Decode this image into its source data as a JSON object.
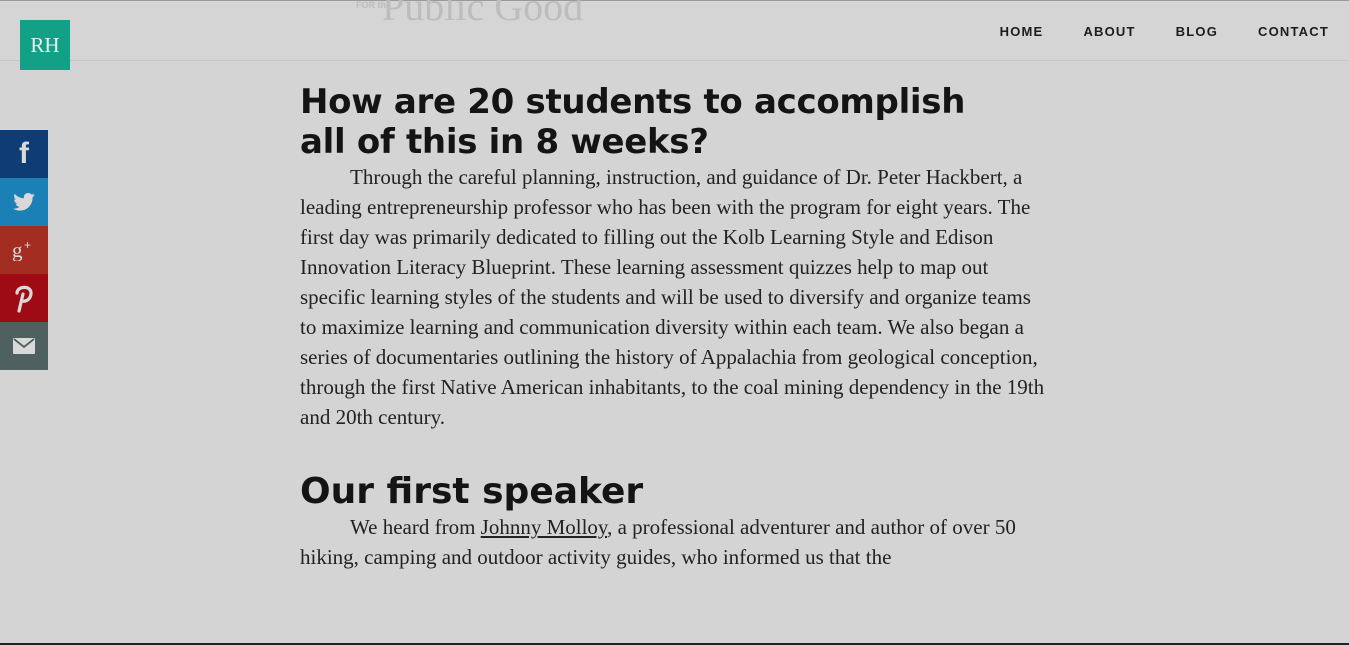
{
  "header": {
    "logo_text": "RH",
    "banner_small": "FOR the",
    "banner_text": "Public Good",
    "nav": [
      "HOME",
      "ABOUT",
      "BLOG",
      "CONTACT"
    ]
  },
  "social": {
    "icons": [
      "facebook-icon",
      "twitter-icon",
      "google-plus-icon",
      "pinterest-icon",
      "email-icon"
    ],
    "colors": {
      "facebook": "#0d3d74",
      "twitter": "#1b80b5",
      "google_plus": "#a42d22",
      "pinterest": "#9f0b14",
      "email": "#4e6060"
    }
  },
  "article": {
    "heading_1": "How are 20 students to accomplish all of this in 8 weeks?",
    "paragraph_1": "Through the careful planning, instruction, and guidance of Dr. Peter Hackbert, a leading entrepreneurship professor who has been with the program for eight years. The first day was primarily dedicated to filling out the Kolb Learning Style and Edison Innovation Literacy Blueprint. These learning assessment quizzes help to map out specific learning styles of the students and will be used to diversify and organize teams to maximize learning and communication diversity within each team. We also began a series of documentaries outlining the history of Appalachia from geological conception, through the first Native American inhabitants, to the coal mining dependency in the 19th and 20th century.",
    "heading_2": "Our first speaker",
    "paragraph_2_pre": "We heard from ",
    "paragraph_2_link": "Johnny Molloy",
    "paragraph_2_post": ", a professional adventurer and author of over 50 hiking, camping and outdoor activity guides, who informed us that the"
  },
  "colors": {
    "background": "#d4d4d4",
    "logo_bg": "#12a187",
    "text": "#1f1f1f"
  }
}
